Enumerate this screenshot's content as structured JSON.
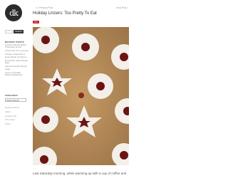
{
  "logo": {
    "text": "dk"
  },
  "nav": {
    "previous": "<< Previous Post",
    "next": "Next Post >"
  },
  "post": {
    "title": "Holiday Linzers: Too Pretty To Eat",
    "pin_label": "Pin",
    "intro": "Last Saturday morning, while warming up with a cup of coffee and"
  },
  "search": {
    "placeholder": "",
    "button": "Search"
  },
  "sidebar": {
    "recent_heading": "RECENT POSTS",
    "recent_posts": [
      "Hazelnut Brown Butter Chocolate Chunk",
      "Greek Pan Pop a Lumps",
      "Orange, Grapefruit & Green Bean Couscous",
      "Nut Pecan Carrot Bread Bars",
      "Spiced Pumpkin Bundt Cake",
      "Avery's Cheddar Buttermilk Biscuits"
    ],
    "archives_heading": "ARCHIVES",
    "archives_select": "Select Month",
    "footer_links": [
      "Recipe Archive",
      "About",
      "Contact Info",
      "Print Shop",
      "Press"
    ]
  },
  "colors": {
    "background": "#b08a5c",
    "sugar": "#f3efe9",
    "jam": "#6b1414"
  }
}
